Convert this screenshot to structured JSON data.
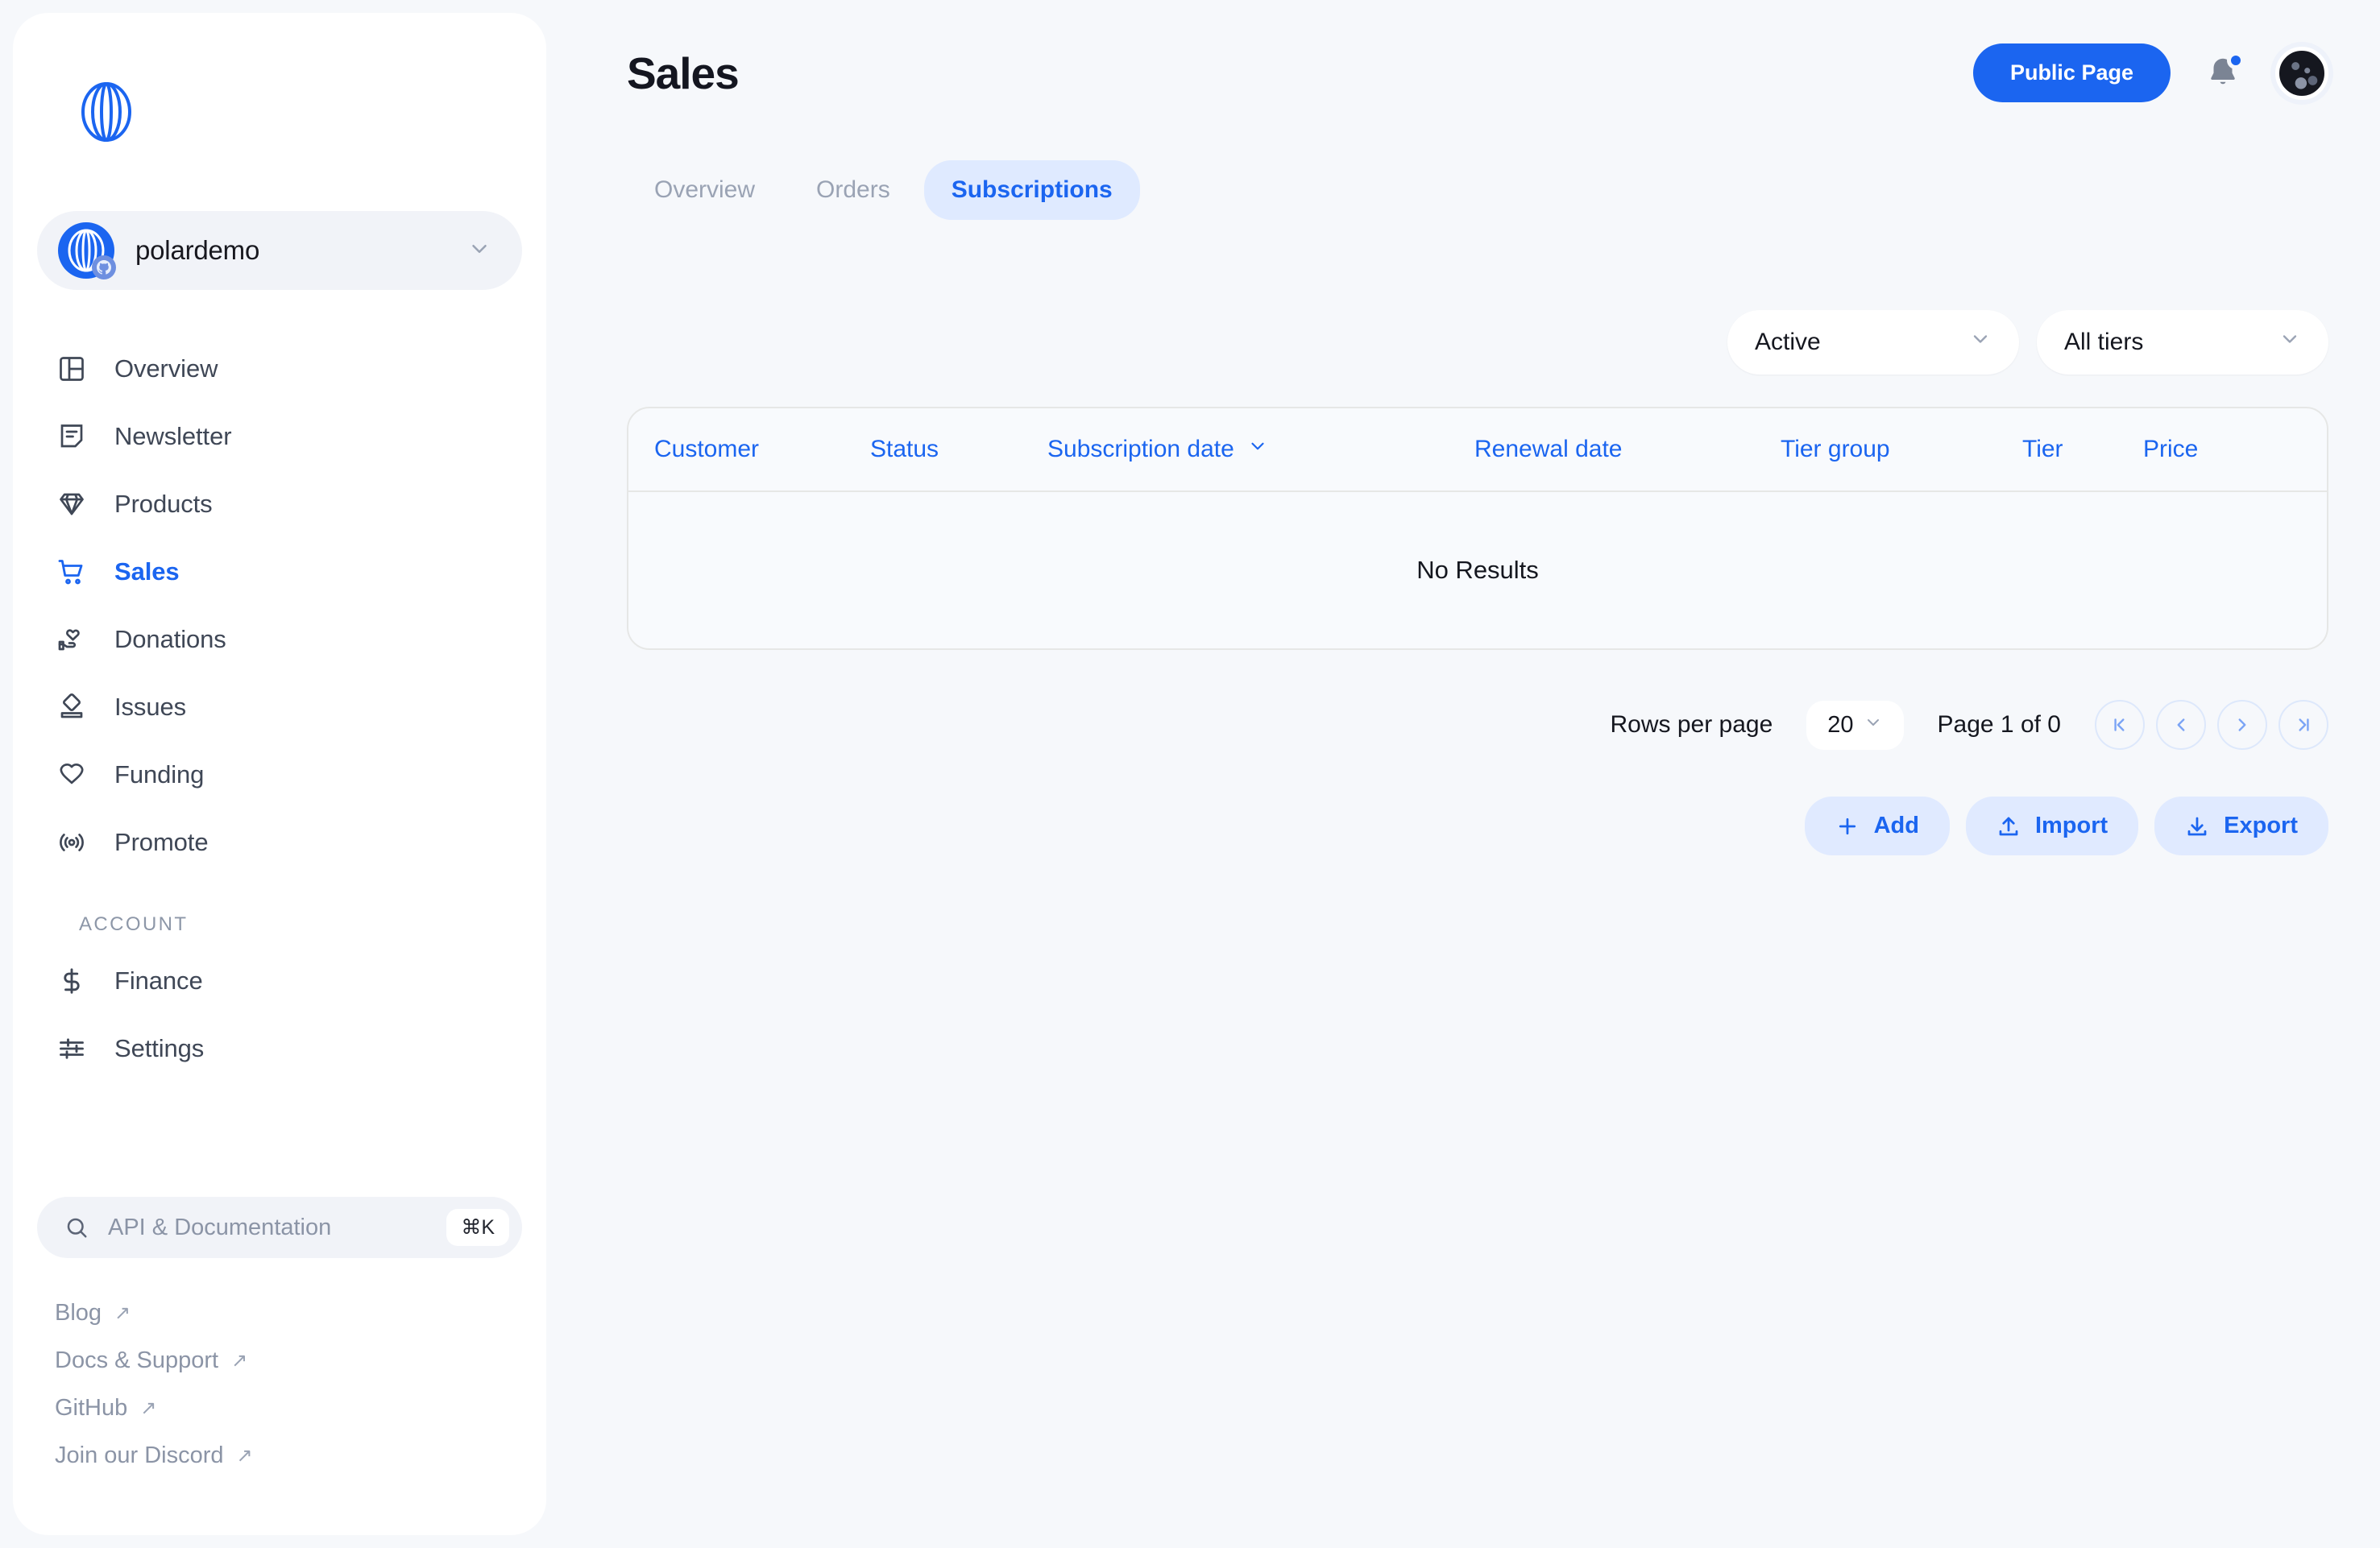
{
  "sidebar": {
    "brand_icon": "polar-logo-icon",
    "org": {
      "name": "polardemo",
      "avatar_icon": "polar-org-avatar",
      "badge_icon": "github-badge-icon",
      "chevron_icon": "chevron-down-icon"
    },
    "nav": [
      {
        "label": "Overview",
        "icon": "layout-dashboard-icon",
        "active": false
      },
      {
        "label": "Newsletter",
        "icon": "newsletter-note-icon",
        "active": false
      },
      {
        "label": "Products",
        "icon": "diamond-icon",
        "active": false
      },
      {
        "label": "Sales",
        "icon": "shopping-cart-icon",
        "active": true
      },
      {
        "label": "Donations",
        "icon": "hand-heart-icon",
        "active": false
      },
      {
        "label": "Issues",
        "icon": "issue-stamp-icon",
        "active": false
      },
      {
        "label": "Funding",
        "icon": "heart-icon",
        "active": false
      },
      {
        "label": "Promote",
        "icon": "broadcast-icon",
        "active": false
      }
    ],
    "account_section_label": "ACCOUNT",
    "account_nav": [
      {
        "label": "Finance",
        "icon": "dollar-icon",
        "active": false
      },
      {
        "label": "Settings",
        "icon": "sliders-icon",
        "active": false
      }
    ],
    "search": {
      "placeholder": "API & Documentation",
      "shortcut": "⌘K",
      "icon": "search-icon"
    },
    "links": [
      {
        "label": "Blog",
        "icon": "external-link-icon"
      },
      {
        "label": "Docs & Support",
        "icon": "external-link-icon"
      },
      {
        "label": "GitHub",
        "icon": "external-link-icon"
      },
      {
        "label": "Join our Discord",
        "icon": "external-link-icon"
      }
    ]
  },
  "header": {
    "title": "Sales",
    "public_page_label": "Public Page",
    "bell_icon": "bell-icon",
    "has_notification": true,
    "avatar_icon": "user-avatar"
  },
  "tabs": [
    {
      "label": "Overview",
      "active": false
    },
    {
      "label": "Orders",
      "active": false
    },
    {
      "label": "Subscriptions",
      "active": true
    }
  ],
  "filters": {
    "status": {
      "value": "Active",
      "chevron_icon": "chevron-down-icon"
    },
    "tier": {
      "value": "All tiers",
      "chevron_icon": "chevron-down-icon"
    }
  },
  "table": {
    "columns": [
      {
        "label": "Customer",
        "sortable": false
      },
      {
        "label": "Status",
        "sortable": false
      },
      {
        "label": "Subscription date",
        "sortable": true
      },
      {
        "label": "Renewal date",
        "sortable": false
      },
      {
        "label": "Tier group",
        "sortable": false
      },
      {
        "label": "Tier",
        "sortable": false
      },
      {
        "label": "Price",
        "sortable": false
      }
    ],
    "rows": [],
    "empty_message": "No Results"
  },
  "pagination": {
    "rows_per_page_label": "Rows per page",
    "rows_per_page_value": "20",
    "page_indicator": "Page 1 of 0",
    "buttons": [
      {
        "icon": "first-page-icon",
        "glyph": "⏮"
      },
      {
        "icon": "prev-page-icon",
        "glyph": "‹"
      },
      {
        "icon": "next-page-icon",
        "glyph": "›"
      },
      {
        "icon": "last-page-icon",
        "glyph": "⏭"
      }
    ]
  },
  "actions": [
    {
      "label": "Add",
      "icon": "plus-icon"
    },
    {
      "label": "Import",
      "icon": "upload-icon"
    },
    {
      "label": "Export",
      "icon": "download-icon"
    }
  ],
  "colors": {
    "accent": "#1b65f0",
    "accent_soft": "#e0eaff",
    "page_bg": "#f6f8fb",
    "sidebar_bg": "#ffffff",
    "muted_text": "#8b94a6"
  }
}
